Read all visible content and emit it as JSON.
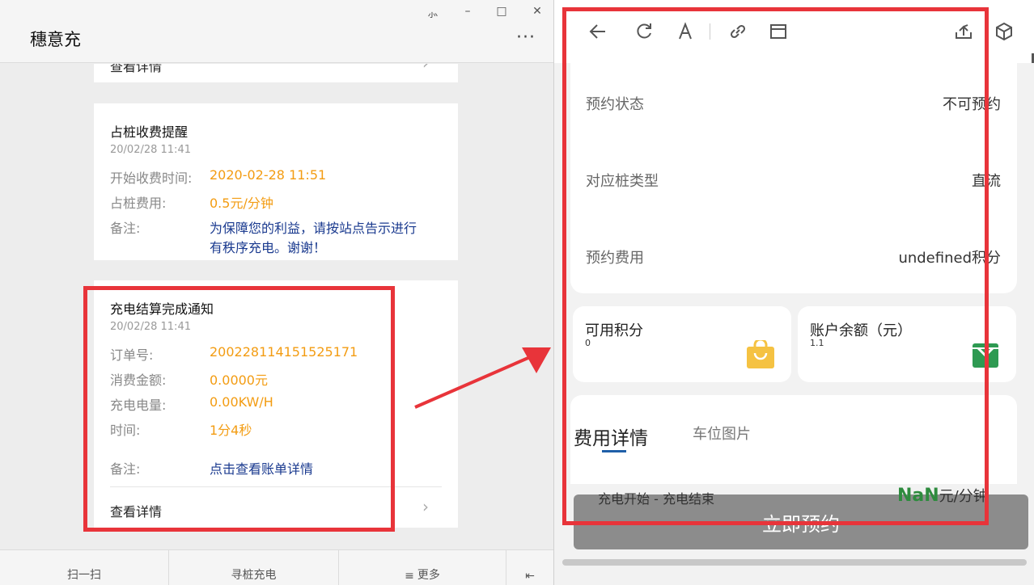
{
  "app": {
    "title": "穗意充",
    "more": "···"
  },
  "window_controls": {
    "pin": "⺗",
    "minimize": "–",
    "maximize": "□",
    "close": "✕"
  },
  "cards": {
    "prev_detail": "查看详情",
    "occupy": {
      "title": "占桩收费提醒",
      "time": "20/02/28 11:41",
      "start_label": "开始收费时间:",
      "start_val": "2020-02-28 11:51",
      "fee_label": "占桩费用:",
      "fee_val": "0.5元/分钟",
      "note_label": "备注:",
      "note_line1": "为保障您的利益，请按站点告示进行",
      "note_line2": "有秩序充电。谢谢！"
    },
    "settle": {
      "title": "充电结算完成通知",
      "time": "20/02/28 11:41",
      "order_label": "订单号:",
      "order_val": "200228114151525171",
      "amount_label": "消费金额:",
      "amount_val": "0.0000元",
      "energy_label": "充电电量:",
      "energy_val": "0.00KW/H",
      "duration_label": "时间:",
      "duration_val": "1分4秒",
      "note_label": "备注:",
      "note_val": "点击查看账单详情",
      "detail": "查看详情"
    }
  },
  "bottom_menu": {
    "scan": "扫一扫",
    "find": "寻桩充电",
    "more": "更多",
    "collapse": "⇤"
  },
  "mini": {
    "reserve_status_label": "预约状态",
    "reserve_status_val": "不可预约",
    "pile_type_label": "对应桩类型",
    "pile_type_val": "直流",
    "reserve_fee_label": "预约费用",
    "reserve_fee_val": "undefined积分",
    "points_label": "可用积分",
    "points_val": "0",
    "balance_label": "账户余额（元）",
    "balance_val": "1.1",
    "tab_fee": "费用详情",
    "tab_photo": "车位图片",
    "book_button": "立即预约",
    "bottom_hint": "充电开始 - 充电结束",
    "price_nan": "NaN",
    "price_unit": "元/分钟"
  },
  "colors": {
    "accent_orange": "#f39c12",
    "link_blue": "#1a3a8f",
    "annotation_red": "#e8343a",
    "tab_blue": "#1f5fa8",
    "bag_yellow": "#f5c242",
    "wallet_green": "#2e9a52"
  }
}
